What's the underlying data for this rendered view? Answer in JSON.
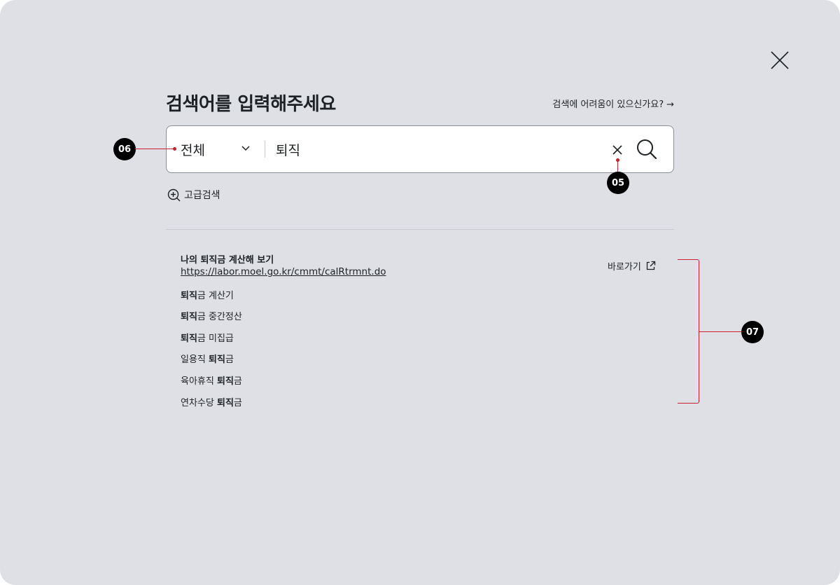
{
  "header": {
    "title": "검색어를 입력해주세요",
    "help_link": "검색에 어려움이 있으신가요?",
    "help_arrow": "→"
  },
  "search": {
    "scope_value": "전체",
    "query_value": "퇴직",
    "placeholder": ""
  },
  "advanced_search_label": "고급검색",
  "featured": {
    "title_pre": "나의 ",
    "title_bold": "퇴직",
    "title_post": "금 계산해 보기",
    "url": "https://labor.moel.go.kr/cmmt/calRtrmnt.do",
    "goto_label": "바로가기"
  },
  "suggestions": [
    {
      "pre": "",
      "bold": "퇴직",
      "post": "금 계산기"
    },
    {
      "pre": "",
      "bold": "퇴직",
      "post": "금 중간정산"
    },
    {
      "pre": "",
      "bold": "퇴직",
      "post": "금 미집급"
    },
    {
      "pre": "일용직 ",
      "bold": "퇴직",
      "post": "금"
    },
    {
      "pre": "육아휴직 ",
      "bold": "퇴직",
      "post": "금"
    },
    {
      "pre": "연차수당 ",
      "bold": "퇴직",
      "post": "금"
    }
  ],
  "annotations": {
    "clear": "05",
    "scope": "06",
    "results": "07"
  },
  "colors": {
    "overlay_bg": "#dee0e6",
    "annotation_red": "#c8202f",
    "badge_bg": "#000000"
  }
}
